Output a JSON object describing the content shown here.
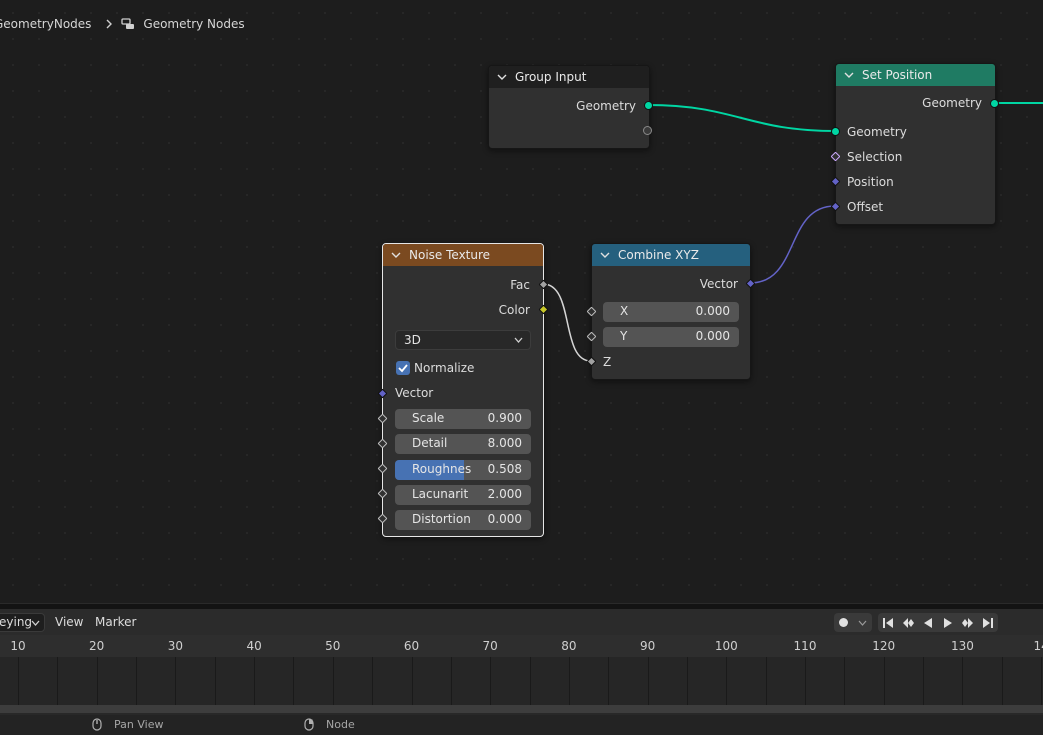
{
  "breadcrumb": {
    "tree": "GeometryNodes",
    "group": "Geometry Nodes"
  },
  "nodes": {
    "group_input": {
      "title": "Group Input",
      "outputs": [
        "Geometry"
      ]
    },
    "set_position": {
      "title": "Set Position",
      "output": "Geometry",
      "inputs": [
        "Geometry",
        "Selection",
        "Position",
        "Offset"
      ]
    },
    "noise_texture": {
      "title": "Noise Texture",
      "outputs": [
        "Fac",
        "Color"
      ],
      "dimensions": "3D",
      "normalize_label": "Normalize",
      "normalize_checked": true,
      "vector_label": "Vector",
      "fields": [
        {
          "label": "Scale",
          "value": "0.900"
        },
        {
          "label": "Detail",
          "value": "8.000"
        },
        {
          "label": "Roughnes",
          "value": "0.508",
          "fraction": 0.508
        },
        {
          "label": "Lacunarit",
          "value": "2.000"
        },
        {
          "label": "Distortion",
          "value": "0.000"
        }
      ]
    },
    "combine_xyz": {
      "title": "Combine XYZ",
      "output": "Vector",
      "fields": [
        {
          "label": "X",
          "value": "0.000"
        },
        {
          "label": "Y",
          "value": "0.000"
        }
      ],
      "z_label": "Z"
    }
  },
  "colors": {
    "geometry_socket": "#00d6a3",
    "vector_socket": "#6363c7",
    "color_socket": "#c7c729",
    "float_socket": "#a1a1a1",
    "selection_socket": "#ccaaff",
    "noise_header": "#7b4a20",
    "combine_header": "#25607e",
    "setpos_header": "#1f7b63",
    "slider_fill": "#4772b3"
  },
  "timeline": {
    "mode_label": "eying",
    "menu": [
      "View",
      "Marker"
    ],
    "ruler_labels": [
      "10",
      "20",
      "30",
      "40",
      "50",
      "60",
      "70",
      "80",
      "90",
      "100",
      "110",
      "120",
      "130",
      "14"
    ]
  },
  "status": {
    "left": "Pan View",
    "right": "Node"
  },
  "icons": {
    "breadcrumb_separator": "chevron-right-icon",
    "node_group": "node-tree-icon",
    "collapse": "chevron-down-icon",
    "record": "record-icon",
    "jump_start": "jump-start-icon",
    "prev_keyframe": "prev-keyframe-icon",
    "play_reverse": "play-reverse-icon",
    "play": "play-icon",
    "next_keyframe": "next-keyframe-icon",
    "jump_end": "jump-end-icon",
    "mouse": "mouse-icon"
  }
}
